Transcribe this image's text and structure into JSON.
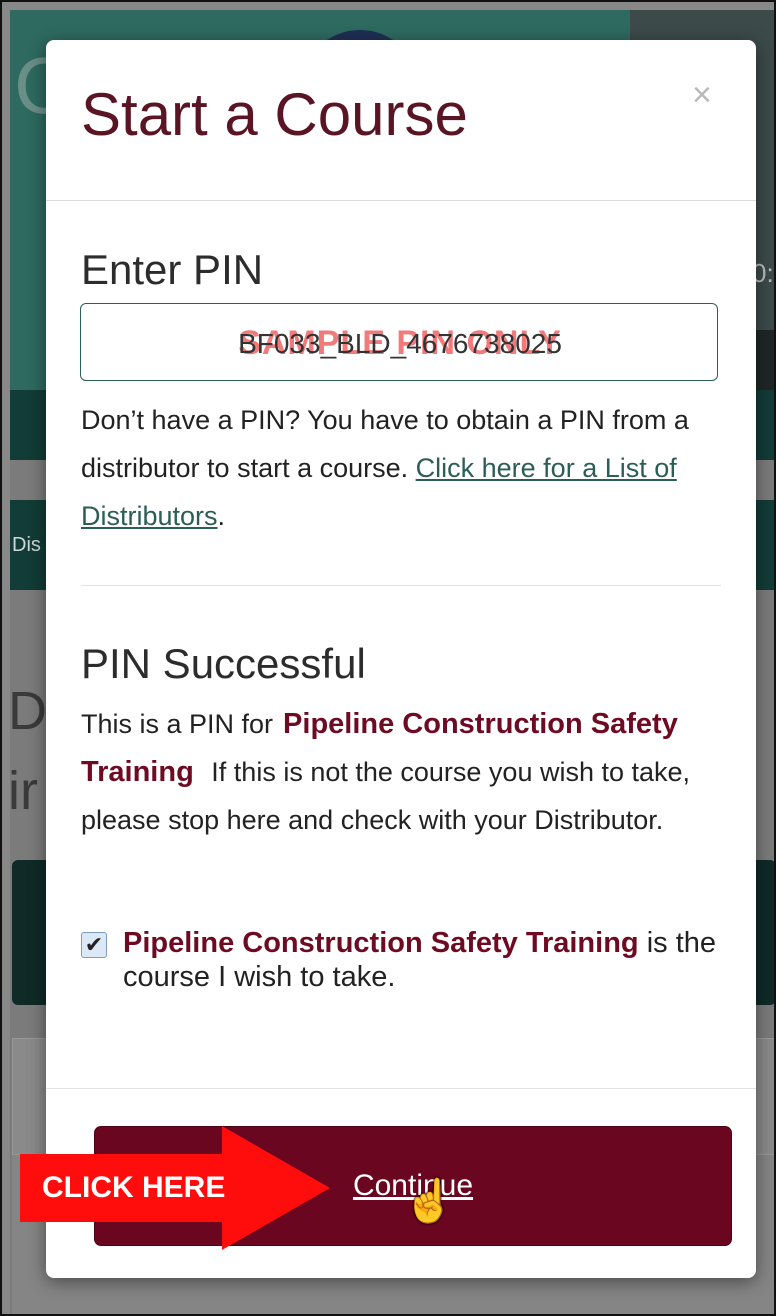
{
  "background": {
    "timecode_fragment": "0:",
    "big_letter": "C",
    "tab_fragment": "Dis",
    "letter_d": "D",
    "letter_i": "ir"
  },
  "modal": {
    "title": "Start a Course",
    "close_glyph": "×",
    "pin_section": {
      "heading": "Enter PIN",
      "input_value": "BF033_BLD_4676738025",
      "watermark": "SAMPLE PIN ONLY",
      "help_text": "Don’t have a PIN? You have to obtain a PIN from a distributor to start a course. ",
      "help_link": "Click here for a List of Distributors",
      "help_suffix": "."
    },
    "success_section": {
      "heading": "PIN Successful",
      "prefix": "This is a PIN for",
      "course_name": "Pipeline Construction Safety Training",
      "suffix": " If this is not the course you wish to take, please stop here and check with your Distributor."
    },
    "confirm": {
      "checked": true,
      "check_glyph": "✔",
      "course_name": "Pipeline Construction Safety Training",
      "text": " is the course I wish to take."
    },
    "continue_label": "Continue"
  },
  "annotation": {
    "label": "CLICK HERE",
    "color": "#ff0d0d"
  },
  "colors": {
    "brand_maroon": "#6a0620",
    "title_color": "#5a1525",
    "link_teal": "#2c5e56"
  }
}
